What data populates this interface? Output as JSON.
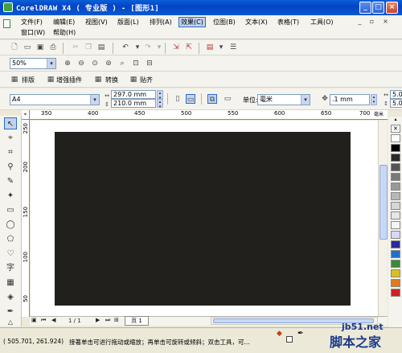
{
  "window": {
    "title": "CorelDRAW X4 ( 专业版 ) - [图形1]"
  },
  "menu": {
    "items": [
      "文件(F)",
      "编辑(E)",
      "视图(V)",
      "版面(L)",
      "排列(A)",
      "效果(C)",
      "位图(B)",
      "文本(X)",
      "表格(T)",
      "工具(O)"
    ],
    "row2": [
      "窗口(W)",
      "帮助(H)"
    ],
    "selected": "效果(C)"
  },
  "zoom": {
    "value": "50%"
  },
  "plugins": {
    "items": [
      "排版",
      "增强插件",
      "转换",
      "贴齐"
    ]
  },
  "property_bar": {
    "page_size": "A4",
    "width": "297.0 mm",
    "height": "210.0 mm",
    "units_label": "单位:",
    "units_value": "毫米",
    "nudge": ".1 mm",
    "dup_x": "5.0",
    "dup_y": "5.0"
  },
  "ruler": {
    "h_labels": [
      "350",
      "400",
      "450",
      "500",
      "550",
      "600",
      "650",
      "700"
    ],
    "v_labels": [
      "250",
      "200",
      "150",
      "100",
      "50"
    ],
    "unit": "毫米"
  },
  "page_nav": {
    "position": "1 / 1",
    "tab": "页 1"
  },
  "status": {
    "coords": "( 505.701, 261.924)",
    "hint": "接著单击可进行拖动或缩放；再单击可旋转或倾斜；双击工具，可..."
  },
  "palette": {
    "colors": [
      "#ffffff",
      "#000000",
      "#2a2a2a",
      "#555555",
      "#7a7a7a",
      "#999999",
      "#b8b8b8",
      "#d6d6d6",
      "#e6e6e6",
      "#f4f4f4",
      "#d8d8f4",
      "#2a2a9a",
      "#2070c8",
      "#3a8a3a",
      "#d8c020",
      "#e07a20",
      "#d02020"
    ]
  },
  "watermark": {
    "line1": "jb51.net",
    "line2": "脚本之家"
  }
}
